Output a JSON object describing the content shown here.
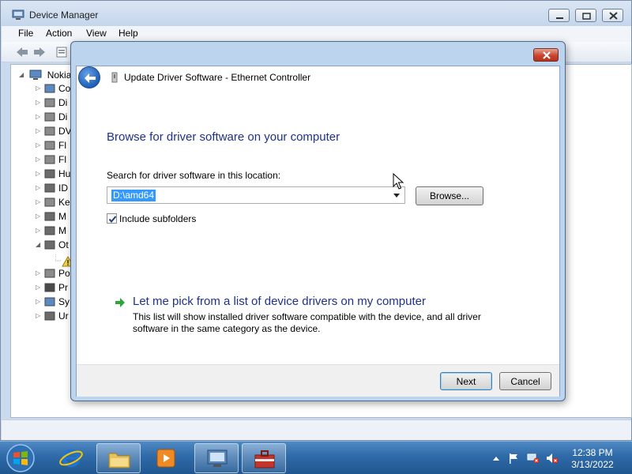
{
  "device_manager": {
    "title": "Device Manager",
    "menu": [
      "File",
      "Action",
      "View",
      "Help"
    ],
    "tree": {
      "root_label": "Nokia",
      "items": [
        "Co",
        "Di",
        "Di",
        "DV",
        "Fl",
        "Fl",
        "Hu",
        "ID",
        "Ke",
        "M",
        "M",
        "Ot",
        "Po",
        "Pr",
        "Sy",
        "Ur"
      ]
    }
  },
  "dialog": {
    "title": "Update Driver Software - Ethernet Controller",
    "heading": "Browse for driver software on your computer",
    "search_label": "Search for driver software in this location:",
    "path_value": "D:\\amd64",
    "browse_label": "Browse...",
    "include_subfolders_label": "Include subfolders",
    "include_subfolders_checked": true,
    "pick_link": "Let me pick from a list of device drivers on my computer",
    "pick_description": "This list will show installed driver software compatible with the device, and all driver software in the same category as the device.",
    "next_label": "Next",
    "cancel_label": "Cancel"
  },
  "taskbar": {
    "clock_time": "12:38 PM",
    "clock_date": "3/13/2022"
  },
  "icons": {
    "back": "back-arrow-icon",
    "device": "device-icon",
    "pick_arrow": "green-arrow-icon",
    "start": "windows-start-orb"
  },
  "colors": {
    "heading": "#1e3287",
    "selection": "#3399ff",
    "taskbar": "#2f6aa8",
    "close_button": "#c8452f"
  }
}
